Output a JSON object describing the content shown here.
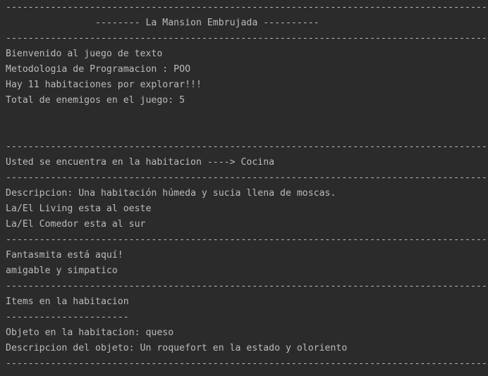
{
  "console": {
    "separator": "----------------------------------------------------------------------------------------------------------",
    "title": "                -------- La Mansion Embrujada ----------",
    "welcome": [
      "Bienvenido al juego de texto",
      "Metodologia de Programacion : POO",
      "Hay 11 habitaciones por explorar!!!",
      "Total de enemigos en el juego: 5"
    ],
    "location": "Usted se encuentra en la habitacion ----> Cocina",
    "room_description": [
      "Descripcion: Una habitación húmeda y sucia llena de moscas.",
      "La/El Living esta al oeste",
      "La/El Comedor esta al sur"
    ],
    "enemy": [
      "Fantasmita está aquí!",
      "amigable y simpatico"
    ],
    "items_header": "Items en la habitacion",
    "items_rule": "----------------------",
    "items": [
      "Objeto en la habitacion: queso",
      "Descripcion del objeto: Un roquefort en la estado y oloriento"
    ]
  }
}
